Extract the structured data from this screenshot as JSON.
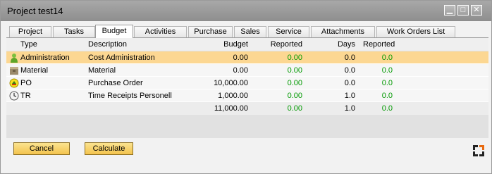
{
  "window": {
    "title": "Project test14"
  },
  "tabs": [
    "Project",
    "Tasks",
    "Budget",
    "Activities",
    "Purchase",
    "Sales",
    "Service",
    "Attachments",
    "Work Orders List"
  ],
  "table": {
    "headers": {
      "type": "Type",
      "description": "Description",
      "budget": "Budget",
      "reported1": "Reported",
      "days": "Days",
      "reported2": "Reported"
    },
    "rows": [
      {
        "icon": "person-icon",
        "type": "Administration",
        "description": "Cost Administration",
        "budget": "0.00",
        "reported": "0.00",
        "days": "0.0",
        "days_reported": "0.0"
      },
      {
        "icon": "material-icon",
        "type": "Material",
        "description": "Material",
        "budget": "0.00",
        "reported": "0.00",
        "days": "0.0",
        "days_reported": "0.0"
      },
      {
        "icon": "purchase-order-icon",
        "type": "PO",
        "description": "Purchase Order",
        "budget": "10,000.00",
        "reported": "0.00",
        "days": "0.0",
        "days_reported": "0.0"
      },
      {
        "icon": "clock-icon",
        "type": "TR",
        "description": "Time Receipts Personell",
        "budget": "1,000.00",
        "reported": "0.00",
        "days": "1.0",
        "days_reported": "0.0"
      }
    ],
    "totals": {
      "budget": "11,000.00",
      "reported": "0.00",
      "days": "1.0",
      "days_reported": "0.0"
    }
  },
  "buttons": {
    "cancel": "Cancel",
    "calculate": "Calculate"
  },
  "colors": {
    "selected_row": "#fcd792",
    "reported_value": "#009900",
    "button": "#f3c34e"
  }
}
